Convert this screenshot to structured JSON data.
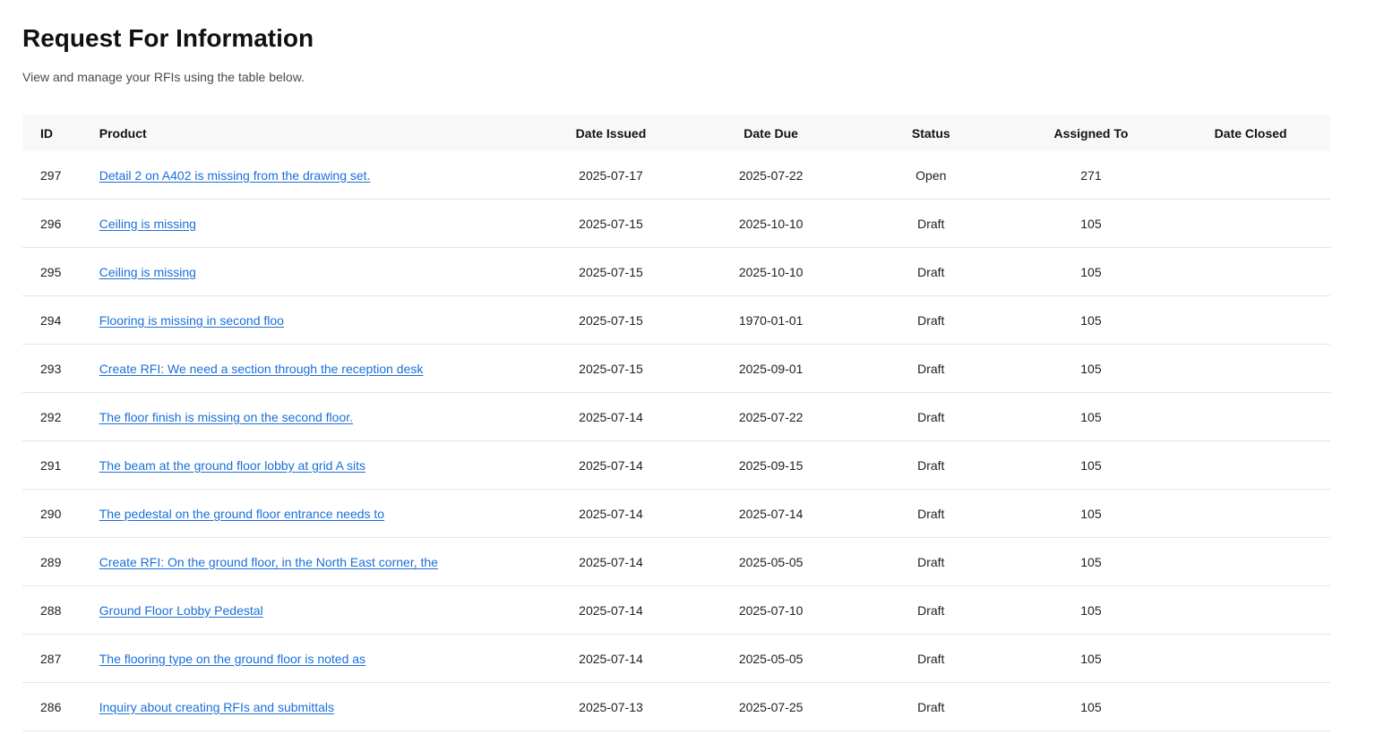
{
  "page": {
    "title": "Request For Information",
    "subtitle": "View and manage your RFIs using the table below."
  },
  "table": {
    "headers": {
      "id": "ID",
      "product": "Product",
      "date_issued": "Date Issued",
      "date_due": "Date Due",
      "status": "Status",
      "assigned_to": "Assigned To",
      "date_closed": "Date Closed"
    },
    "rows": [
      {
        "id": "297",
        "product": "Detail 2 on A402 is missing from the drawing set.",
        "date_issued": "2025-07-17",
        "date_due": "2025-07-22",
        "status": "Open",
        "assigned_to": "271",
        "date_closed": ""
      },
      {
        "id": "296",
        "product": "Ceiling is missing",
        "date_issued": "2025-07-15",
        "date_due": "2025-10-10",
        "status": "Draft",
        "assigned_to": "105",
        "date_closed": ""
      },
      {
        "id": "295",
        "product": "Ceiling is missing",
        "date_issued": "2025-07-15",
        "date_due": "2025-10-10",
        "status": "Draft",
        "assigned_to": "105",
        "date_closed": ""
      },
      {
        "id": "294",
        "product": "Flooring is missing in second floo",
        "date_issued": "2025-07-15",
        "date_due": "1970-01-01",
        "status": "Draft",
        "assigned_to": "105",
        "date_closed": ""
      },
      {
        "id": "293",
        "product": "Create RFI: We need a section through the reception desk",
        "date_issued": "2025-07-15",
        "date_due": "2025-09-01",
        "status": "Draft",
        "assigned_to": "105",
        "date_closed": ""
      },
      {
        "id": "292",
        "product": "The floor finish is missing on the second floor.",
        "date_issued": "2025-07-14",
        "date_due": "2025-07-22",
        "status": "Draft",
        "assigned_to": "105",
        "date_closed": ""
      },
      {
        "id": "291",
        "product": "The beam at the ground floor lobby at grid A sits",
        "date_issued": "2025-07-14",
        "date_due": "2025-09-15",
        "status": "Draft",
        "assigned_to": "105",
        "date_closed": ""
      },
      {
        "id": "290",
        "product": "The pedestal on the ground floor entrance needs to",
        "date_issued": "2025-07-14",
        "date_due": "2025-07-14",
        "status": "Draft",
        "assigned_to": "105",
        "date_closed": ""
      },
      {
        "id": "289",
        "product": "Create RFI: On the ground floor, in the North East corner, the",
        "date_issued": "2025-07-14",
        "date_due": "2025-05-05",
        "status": "Draft",
        "assigned_to": "105",
        "date_closed": ""
      },
      {
        "id": "288",
        "product": "Ground Floor Lobby Pedestal",
        "date_issued": "2025-07-14",
        "date_due": "2025-07-10",
        "status": "Draft",
        "assigned_to": "105",
        "date_closed": ""
      },
      {
        "id": "287",
        "product": "The flooring type on the ground floor is noted as",
        "date_issued": "2025-07-14",
        "date_due": "2025-05-05",
        "status": "Draft",
        "assigned_to": "105",
        "date_closed": ""
      },
      {
        "id": "286",
        "product": "Inquiry about creating RFIs and submittals",
        "date_issued": "2025-07-13",
        "date_due": "2025-07-25",
        "status": "Draft",
        "assigned_to": "105",
        "date_closed": ""
      }
    ]
  }
}
